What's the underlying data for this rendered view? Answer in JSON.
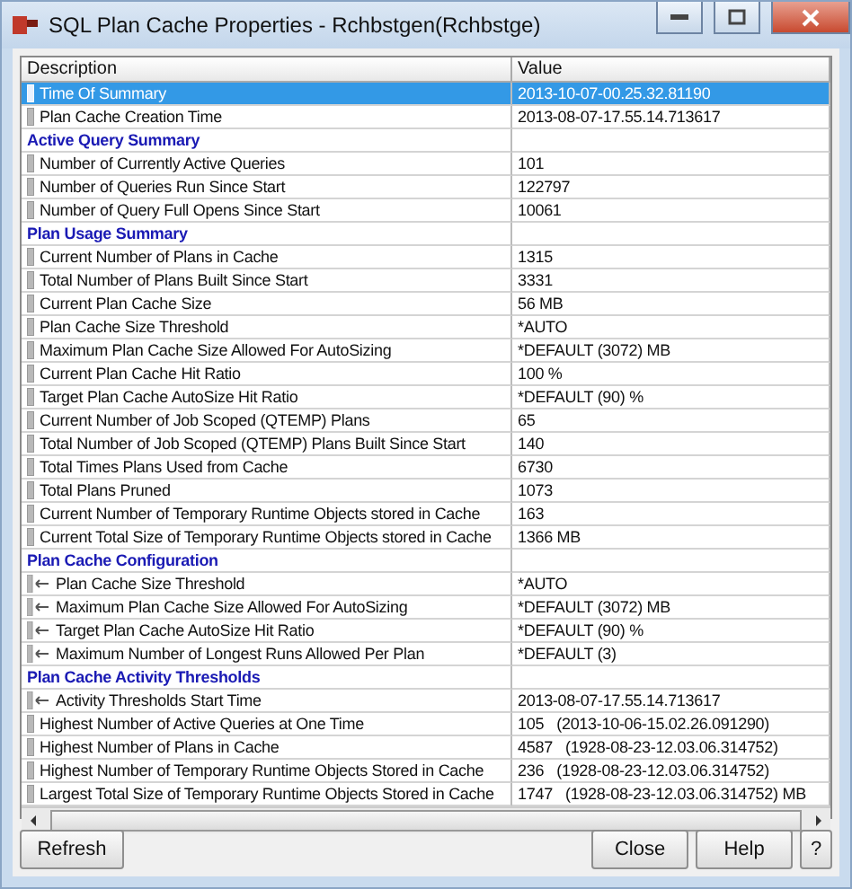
{
  "window": {
    "title": "SQL Plan Cache Properties - Rchbstgen(Rchbstge)"
  },
  "table": {
    "columns": [
      "Description",
      "Value"
    ],
    "rows": [
      {
        "kind": "item",
        "description": "Time Of Summary",
        "value": "2013-10-07-00.25.32.81190",
        "selected": true
      },
      {
        "kind": "item",
        "description": "Plan Cache Creation Time",
        "value": "2013-08-07-17.55.14.713617",
        "selected": false
      },
      {
        "kind": "section",
        "description": "Active Query Summary",
        "selected": false
      },
      {
        "kind": "item",
        "description": "Number of Currently Active Queries",
        "value": "101",
        "selected": false
      },
      {
        "kind": "item",
        "description": "Number of Queries Run Since Start",
        "value": "122797",
        "selected": false
      },
      {
        "kind": "item",
        "description": "Number of Query Full Opens Since Start",
        "value": "10061",
        "selected": false
      },
      {
        "kind": "section",
        "description": "Plan Usage Summary",
        "selected": false
      },
      {
        "kind": "item",
        "description": "Current Number of Plans in Cache",
        "value": "1315",
        "selected": false
      },
      {
        "kind": "item",
        "description": "Total Number of Plans Built Since Start",
        "value": "3331",
        "selected": false
      },
      {
        "kind": "item",
        "description": "Current Plan Cache Size",
        "value": "56 MB",
        "selected": false
      },
      {
        "kind": "item",
        "description": "Plan Cache Size Threshold",
        "value": "*AUTO",
        "selected": false
      },
      {
        "kind": "item",
        "description": "Maximum Plan Cache Size Allowed For AutoSizing",
        "value": "*DEFAULT (3072) MB",
        "selected": false
      },
      {
        "kind": "item",
        "description": "Current Plan Cache Hit Ratio",
        "value": "100 %",
        "selected": false
      },
      {
        "kind": "item",
        "description": "Target Plan Cache AutoSize Hit Ratio",
        "value": "*DEFAULT (90) %",
        "selected": false
      },
      {
        "kind": "item",
        "description": "Current Number of Job Scoped (QTEMP) Plans",
        "value": "65",
        "selected": false
      },
      {
        "kind": "item",
        "description": "Total Number of Job Scoped (QTEMP) Plans Built Since Start",
        "value": "140",
        "selected": false
      },
      {
        "kind": "item",
        "description": "Total Times Plans Used from Cache",
        "value": "6730",
        "selected": false
      },
      {
        "kind": "item",
        "description": "Total Plans Pruned",
        "value": "1073",
        "selected": false
      },
      {
        "kind": "item",
        "description": "Current Number of Temporary Runtime Objects stored in Cache",
        "value": "163",
        "selected": false
      },
      {
        "kind": "item",
        "description": "Current Total Size of Temporary Runtime Objects stored in Cache",
        "value": "1366 MB",
        "selected": false
      },
      {
        "kind": "section",
        "description": "Plan Cache Configuration",
        "selected": false
      },
      {
        "kind": "setting",
        "description": "Plan Cache Size Threshold",
        "value": "*AUTO",
        "selected": false
      },
      {
        "kind": "setting",
        "description": "Maximum Plan Cache Size Allowed For AutoSizing",
        "value": "*DEFAULT (3072) MB",
        "selected": false
      },
      {
        "kind": "setting",
        "description": "Target Plan Cache AutoSize Hit Ratio",
        "value": "*DEFAULT (90) %",
        "selected": false
      },
      {
        "kind": "setting",
        "description": "Maximum Number of Longest Runs Allowed Per Plan",
        "value": "*DEFAULT (3)",
        "selected": false
      },
      {
        "kind": "section",
        "description": "Plan Cache Activity Thresholds",
        "selected": false
      },
      {
        "kind": "setting",
        "description": "Activity Thresholds Start Time",
        "value": "2013-08-07-17.55.14.713617",
        "selected": false
      },
      {
        "kind": "item",
        "description": "Highest Number of Active Queries at One Time",
        "value": "105   (2013-10-06-15.02.26.091290)",
        "selected": false
      },
      {
        "kind": "item",
        "description": "Highest Number of Plans in Cache",
        "value": "4587   (1928-08-23-12.03.06.314752)",
        "selected": false
      },
      {
        "kind": "item",
        "description": "Highest Number of Temporary Runtime Objects Stored in Cache",
        "value": "236   (1928-08-23-12.03.06.314752)",
        "selected": false
      },
      {
        "kind": "item",
        "description": "Largest Total Size of Temporary Runtime Objects Stored in Cache",
        "value": "1747   (1928-08-23-12.03.06.314752) MB",
        "selected": false
      }
    ]
  },
  "buttons": {
    "left": [
      "Refresh"
    ],
    "right": [
      "Close",
      "Help",
      "?"
    ]
  }
}
